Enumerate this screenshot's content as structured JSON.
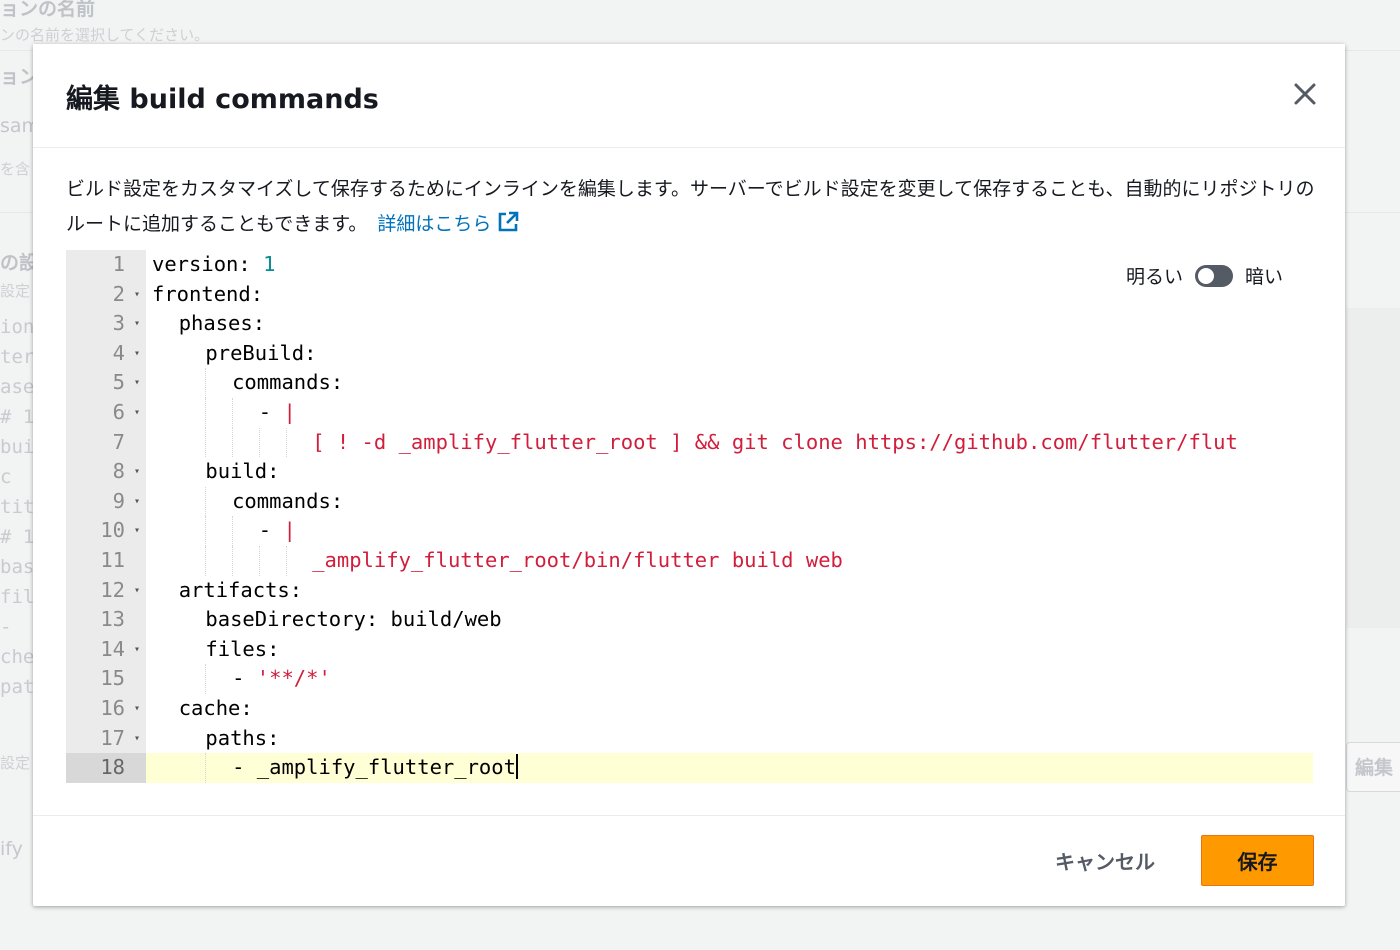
{
  "background": {
    "texts": [
      "ョンの名前",
      "ンの名前を選択してください。",
      "ョン",
      "sam",
      "を含",
      "の設",
      "設定",
      "ify",
      "設定"
    ],
    "code_lines": [
      "ion",
      "ter",
      "ase",
      "# 1",
      "bui",
      "  c",
      "tit",
      "# 1",
      "bas",
      "fil",
      "  -",
      "che",
      "pat"
    ],
    "right_button": "編集"
  },
  "modal": {
    "title": "編集 build commands",
    "description": "ビルド設定をカスタマイズして保存するためにインラインを編集します。サーバーでビルド設定を変更して保存することも、自動的にリポジトリのルートに追加することもできます。",
    "link_text": "詳細はこちら",
    "theme": {
      "light_label": "明るい",
      "dark_label": "暗い"
    },
    "cancel_label": "キャンセル",
    "save_label": "保存"
  },
  "editor": {
    "active_line": 18,
    "lines": [
      {
        "n": "1",
        "fold": false,
        "indent": 0,
        "key": "version:",
        "val": " 1",
        "type": "num"
      },
      {
        "n": "2",
        "fold": true,
        "indent": 0,
        "key": "frontend:",
        "val": "",
        "type": ""
      },
      {
        "n": "3",
        "fold": true,
        "indent": 1,
        "key": "phases:",
        "val": "",
        "type": ""
      },
      {
        "n": "4",
        "fold": true,
        "indent": 2,
        "key": "preBuild:",
        "val": "",
        "type": ""
      },
      {
        "n": "5",
        "fold": true,
        "indent": 3,
        "key": "commands:",
        "val": "",
        "type": ""
      },
      {
        "n": "6",
        "fold": true,
        "indent": 4,
        "key": "- ",
        "val": "|",
        "type": "str"
      },
      {
        "n": "7",
        "fold": false,
        "indent": 6,
        "key": "",
        "val": "[ ! -d _amplify_flutter_root ] && git clone https://github.com/flutter/flut",
        "type": "str"
      },
      {
        "n": "8",
        "fold": true,
        "indent": 2,
        "key": "build:",
        "val": "",
        "type": ""
      },
      {
        "n": "9",
        "fold": true,
        "indent": 3,
        "key": "commands:",
        "val": "",
        "type": ""
      },
      {
        "n": "10",
        "fold": true,
        "indent": 4,
        "key": "- ",
        "val": "|",
        "type": "str"
      },
      {
        "n": "11",
        "fold": false,
        "indent": 6,
        "key": "",
        "val": "_amplify_flutter_root/bin/flutter build web",
        "type": "str"
      },
      {
        "n": "12",
        "fold": true,
        "indent": 1,
        "key": "artifacts:",
        "val": "",
        "type": ""
      },
      {
        "n": "13",
        "fold": false,
        "indent": 2,
        "key": "baseDirectory: build/web",
        "val": "",
        "type": ""
      },
      {
        "n": "14",
        "fold": true,
        "indent": 2,
        "key": "files:",
        "val": "",
        "type": ""
      },
      {
        "n": "15",
        "fold": false,
        "indent": 3,
        "key": "- ",
        "val": "'**/*'",
        "type": "str"
      },
      {
        "n": "16",
        "fold": true,
        "indent": 1,
        "key": "cache:",
        "val": "",
        "type": ""
      },
      {
        "n": "17",
        "fold": true,
        "indent": 2,
        "key": "paths:",
        "val": "",
        "type": ""
      },
      {
        "n": "18",
        "fold": false,
        "indent": 3,
        "key": "- _amplify_flutter_root",
        "val": "",
        "type": ""
      }
    ]
  }
}
